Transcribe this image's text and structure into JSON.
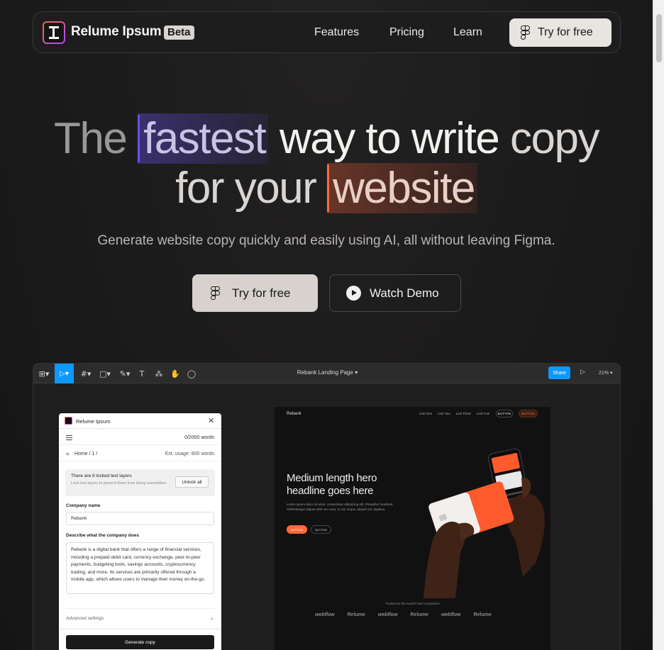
{
  "nav": {
    "brand": "Relume Ipsum",
    "badge": "Beta",
    "links": [
      "Features",
      "Pricing",
      "Learn"
    ],
    "cta_label": "Try for free"
  },
  "hero": {
    "line1": {
      "w1": "The",
      "w2": "fastest",
      "w3": "way to write",
      "w4": "copy"
    },
    "line2": {
      "w1": "for your",
      "w2": "website"
    },
    "subtitle": "Generate website copy quickly and easily using AI, all without leaving Figma.",
    "primary_cta": "Try for free",
    "secondary_cta": "Watch Demo"
  },
  "figma": {
    "file_title": "Rebank Landing Page",
    "share_label": "Share",
    "zoom": "21%",
    "plugin": {
      "title": "Relume Ipsum",
      "word_count": "0/2000 words",
      "breadcrumb": "Home / 1 /",
      "usage": "Est. usage: 800 words",
      "warning_title": "There are 8 locked text layers",
      "warning_text": "Lock text layers to prevent them from being overwritten.",
      "unlock_label": "Unlock all",
      "company_label": "Company name",
      "company_value": "Rebank",
      "describe_label": "Describe what the company does",
      "describe_value": "Rebank is a digital bank that offers a range of financial services, including a prepaid debit card, currency exchange, peer-to-peer payments, budgeting tools, savings accounts, cryptocurrency trading, and more. Its services are primarily offered through a mobile app, which allows users to manage their money on-the-go.",
      "advanced_label": "Advanced settings",
      "generate_label": "Generate copy"
    },
    "site": {
      "logo": "Rebank",
      "links": [
        "Link One",
        "Link Two",
        "Link Three",
        "Link Four"
      ],
      "nav_btn1": "BUTTON",
      "nav_btn2": "BUTTON",
      "headline": "Medium length hero headline goes here",
      "paragraph": "Lorem ipsum dolor sit amet, consectetur adipiscing elit. Phasellus hendrerit. Pellentesque aliquet nibh nec urna. In nisi neque, aliquet vel, dapibus.",
      "cta1": "BUTTON",
      "cta2": "BUTTON",
      "trusted": "Trusted by the world's best companies",
      "logos": [
        "webflow",
        "Relume",
        "webflow",
        "Relume",
        "webflow",
        "Relume"
      ]
    }
  },
  "colors": {
    "background": "#1c1b1b",
    "accent_purple": "#6a4cff",
    "accent_orange": "#ff6a3d",
    "cta_bg": "#e8e4df",
    "figma_blue": "#0d99ff"
  }
}
